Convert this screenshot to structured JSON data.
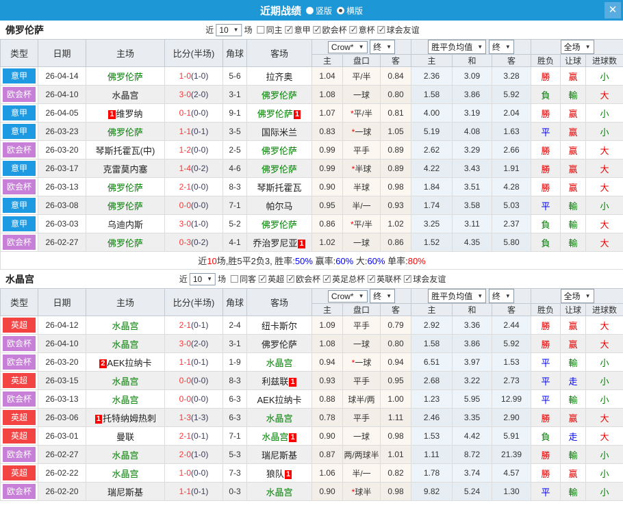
{
  "titlebar": {
    "title": "近期战绩",
    "options": [
      {
        "label": "竖版",
        "checked": false
      },
      {
        "label": "横版",
        "checked": true
      }
    ],
    "close_label": "✕"
  },
  "table_header": {
    "cols": [
      "类型",
      "日期",
      "主场",
      "比分(半场)",
      "角球",
      "客场"
    ],
    "selects": {
      "company": "Crow*",
      "company_term": "终",
      "europe": "胜平负均值",
      "europe_term": "终",
      "scope": "全场"
    },
    "sub": [
      "主",
      "盘口",
      "客",
      "主",
      "和",
      "客",
      "胜负",
      "让球",
      "进球数"
    ]
  },
  "league_colors": {
    "意甲": "#1e9ae2",
    "欧会杯": "#c77fd8",
    "英超": "#f44343"
  },
  "result_colors": {
    "r": "#e60000",
    "g": "#008000",
    "b": "#0000ee"
  },
  "summary_colors": {
    "k": "#333333",
    "r": "#ff0000",
    "b": "#0000ff"
  },
  "sections": [
    {
      "team": "佛罗伦萨",
      "filter": {
        "prefix": "近",
        "count": "10",
        "suffix": "场",
        "same": {
          "label": "同主",
          "checked": false
        },
        "leagues": [
          {
            "label": "意甲",
            "checked": true
          },
          {
            "label": "欧会杯",
            "checked": true
          },
          {
            "label": "意杯",
            "checked": true
          },
          {
            "label": "球会友谊",
            "checked": true
          }
        ]
      },
      "rows": [
        {
          "lg": "意甲",
          "date": "26-04-14",
          "h": "佛罗伦萨",
          "hg": true,
          "hb": "",
          "hbp": "",
          "sc": "1-0",
          "ht": "(1-0)",
          "cn": "5-6",
          "a": "拉齐奥",
          "ag": false,
          "ab": "",
          "abp": "",
          "o1": "1.04",
          "st": false,
          "hc": "平/半",
          "o2": "0.84",
          "e1": "2.36",
          "e2": "3.09",
          "e3": "3.28",
          "r1": "勝",
          "r1c": "r",
          "r2": "赢",
          "r2c": "r",
          "r3": "小",
          "r3c": "g"
        },
        {
          "lg": "欧会杯",
          "date": "26-04-10",
          "h": "水晶宫",
          "hg": false,
          "hb": "",
          "hbp": "",
          "sc": "3-0",
          "ht": "(2-0)",
          "cn": "3-1",
          "a": "佛罗伦萨",
          "ag": true,
          "ab": "",
          "abp": "",
          "o1": "1.08",
          "st": false,
          "hc": "一球",
          "o2": "0.80",
          "e1": "1.58",
          "e2": "3.86",
          "e3": "5.92",
          "r1": "負",
          "r1c": "g",
          "r2": "輸",
          "r2c": "g",
          "r3": "大",
          "r3c": "r"
        },
        {
          "lg": "意甲",
          "date": "26-04-05",
          "h": "维罗纳",
          "hg": false,
          "hb": "1",
          "hbp": "before",
          "sc": "0-1",
          "ht": "(0-0)",
          "cn": "9-1",
          "a": "佛罗伦萨",
          "ag": true,
          "ab": "1",
          "abp": "after",
          "o1": "1.07",
          "st": true,
          "hc": "平/半",
          "o2": "0.81",
          "e1": "4.00",
          "e2": "3.19",
          "e3": "2.04",
          "r1": "勝",
          "r1c": "r",
          "r2": "赢",
          "r2c": "r",
          "r3": "小",
          "r3c": "g"
        },
        {
          "lg": "意甲",
          "date": "26-03-23",
          "h": "佛罗伦萨",
          "hg": true,
          "hb": "",
          "hbp": "",
          "sc": "1-1",
          "ht": "(0-1)",
          "cn": "3-5",
          "a": "国际米兰",
          "ag": false,
          "ab": "",
          "abp": "",
          "o1": "0.83",
          "st": true,
          "hc": "一球",
          "o2": "1.05",
          "e1": "5.19",
          "e2": "4.08",
          "e3": "1.63",
          "r1": "平",
          "r1c": "b",
          "r2": "赢",
          "r2c": "r",
          "r3": "小",
          "r3c": "g"
        },
        {
          "lg": "欧会杯",
          "date": "26-03-20",
          "h": "琴斯托霍瓦(中)",
          "hg": false,
          "hb": "",
          "hbp": "",
          "sc": "1-2",
          "ht": "(0-0)",
          "cn": "2-5",
          "a": "佛罗伦萨",
          "ag": true,
          "ab": "",
          "abp": "",
          "o1": "0.99",
          "st": false,
          "hc": "平手",
          "o2": "0.89",
          "e1": "2.62",
          "e2": "3.29",
          "e3": "2.66",
          "r1": "勝",
          "r1c": "r",
          "r2": "赢",
          "r2c": "r",
          "r3": "大",
          "r3c": "r"
        },
        {
          "lg": "意甲",
          "date": "26-03-17",
          "h": "克雷莫内塞",
          "hg": false,
          "hb": "",
          "hbp": "",
          "sc": "1-4",
          "ht": "(0-2)",
          "cn": "4-6",
          "a": "佛罗伦萨",
          "ag": true,
          "ab": "",
          "abp": "",
          "o1": "0.99",
          "st": true,
          "hc": "半球",
          "o2": "0.89",
          "e1": "4.22",
          "e2": "3.43",
          "e3": "1.91",
          "r1": "勝",
          "r1c": "r",
          "r2": "赢",
          "r2c": "r",
          "r3": "大",
          "r3c": "r"
        },
        {
          "lg": "欧会杯",
          "date": "26-03-13",
          "h": "佛罗伦萨",
          "hg": true,
          "hb": "",
          "hbp": "",
          "sc": "2-1",
          "ht": "(0-0)",
          "cn": "8-3",
          "a": "琴斯托霍瓦",
          "ag": false,
          "ab": "",
          "abp": "",
          "o1": "0.90",
          "st": false,
          "hc": "半球",
          "o2": "0.98",
          "e1": "1.84",
          "e2": "3.51",
          "e3": "4.28",
          "r1": "勝",
          "r1c": "r",
          "r2": "赢",
          "r2c": "r",
          "r3": "大",
          "r3c": "r"
        },
        {
          "lg": "意甲",
          "date": "26-03-08",
          "h": "佛罗伦萨",
          "hg": true,
          "hb": "",
          "hbp": "",
          "sc": "0-0",
          "ht": "(0-0)",
          "cn": "7-1",
          "a": "帕尔马",
          "ag": false,
          "ab": "",
          "abp": "",
          "o1": "0.95",
          "st": false,
          "hc": "半/一",
          "o2": "0.93",
          "e1": "1.74",
          "e2": "3.58",
          "e3": "5.03",
          "r1": "平",
          "r1c": "b",
          "r2": "輸",
          "r2c": "g",
          "r3": "小",
          "r3c": "g"
        },
        {
          "lg": "意甲",
          "date": "26-03-03",
          "h": "乌迪内斯",
          "hg": false,
          "hb": "",
          "hbp": "",
          "sc": "3-0",
          "ht": "(1-0)",
          "cn": "5-2",
          "a": "佛罗伦萨",
          "ag": true,
          "ab": "",
          "abp": "",
          "o1": "0.86",
          "st": true,
          "hc": "平/半",
          "o2": "1.02",
          "e1": "3.25",
          "e2": "3.11",
          "e3": "2.37",
          "r1": "負",
          "r1c": "g",
          "r2": "輸",
          "r2c": "g",
          "r3": "大",
          "r3c": "r"
        },
        {
          "lg": "欧会杯",
          "date": "26-02-27",
          "h": "佛罗伦萨",
          "hg": true,
          "hb": "",
          "hbp": "",
          "sc": "0-3",
          "ht": "(0-2)",
          "cn": "4-1",
          "a": "乔治罗尼亚",
          "ag": false,
          "ab": "1",
          "abp": "after",
          "o1": "1.02",
          "st": false,
          "hc": "一球",
          "o2": "0.86",
          "e1": "1.52",
          "e2": "4.35",
          "e3": "5.80",
          "r1": "負",
          "r1c": "g",
          "r2": "輸",
          "r2c": "g",
          "r3": "大",
          "r3c": "r"
        }
      ],
      "summary": [
        {
          "t": "近",
          "c": "k"
        },
        {
          "t": "10",
          "c": "r"
        },
        {
          "t": "场,胜5平2负3, 胜率:",
          "c": "k"
        },
        {
          "t": "50%",
          "c": "b"
        },
        {
          "t": " 赢率:",
          "c": "k"
        },
        {
          "t": "60%",
          "c": "b"
        },
        {
          "t": " 大:",
          "c": "k"
        },
        {
          "t": "60%",
          "c": "b"
        },
        {
          "t": " 单率:",
          "c": "k"
        },
        {
          "t": "80%",
          "c": "r"
        }
      ]
    },
    {
      "team": "水晶宫",
      "filter": {
        "prefix": "近",
        "count": "10",
        "suffix": "场",
        "same": {
          "label": "同客",
          "checked": false
        },
        "leagues": [
          {
            "label": "英超",
            "checked": true
          },
          {
            "label": "欧会杯",
            "checked": true
          },
          {
            "label": "英足总杯",
            "checked": true
          },
          {
            "label": "英联杯",
            "checked": true
          },
          {
            "label": "球会友谊",
            "checked": true
          }
        ]
      },
      "rows": [
        {
          "lg": "英超",
          "date": "26-04-12",
          "h": "水晶宫",
          "hg": true,
          "hb": "",
          "hbp": "",
          "sc": "2-1",
          "ht": "(0-1)",
          "cn": "2-4",
          "a": "纽卡斯尔",
          "ag": false,
          "ab": "",
          "abp": "",
          "o1": "1.09",
          "st": false,
          "hc": "平手",
          "o2": "0.79",
          "e1": "2.92",
          "e2": "3.36",
          "e3": "2.44",
          "r1": "勝",
          "r1c": "r",
          "r2": "赢",
          "r2c": "r",
          "r3": "大",
          "r3c": "r"
        },
        {
          "lg": "欧会杯",
          "date": "26-04-10",
          "h": "水晶宫",
          "hg": true,
          "hb": "",
          "hbp": "",
          "sc": "3-0",
          "ht": "(2-0)",
          "cn": "3-1",
          "a": "佛罗伦萨",
          "ag": false,
          "ab": "",
          "abp": "",
          "o1": "1.08",
          "st": false,
          "hc": "一球",
          "o2": "0.80",
          "e1": "1.58",
          "e2": "3.86",
          "e3": "5.92",
          "r1": "勝",
          "r1c": "r",
          "r2": "赢",
          "r2c": "r",
          "r3": "大",
          "r3c": "r"
        },
        {
          "lg": "欧会杯",
          "date": "26-03-20",
          "h": "AEK拉纳卡",
          "hg": false,
          "hb": "2",
          "hbp": "before",
          "sc": "1-1",
          "ht": "(0-1)",
          "cn": "1-9",
          "a": "水晶宫",
          "ag": true,
          "ab": "",
          "abp": "",
          "o1": "0.94",
          "st": true,
          "hc": "一球",
          "o2": "0.94",
          "e1": "6.51",
          "e2": "3.97",
          "e3": "1.53",
          "r1": "平",
          "r1c": "b",
          "r2": "輸",
          "r2c": "g",
          "r3": "小",
          "r3c": "g"
        },
        {
          "lg": "英超",
          "date": "26-03-15",
          "h": "水晶宫",
          "hg": true,
          "hb": "",
          "hbp": "",
          "sc": "0-0",
          "ht": "(0-0)",
          "cn": "8-3",
          "a": "利兹联",
          "ag": false,
          "ab": "1",
          "abp": "after",
          "o1": "0.93",
          "st": false,
          "hc": "平手",
          "o2": "0.95",
          "e1": "2.68",
          "e2": "3.22",
          "e3": "2.73",
          "r1": "平",
          "r1c": "b",
          "r2": "走",
          "r2c": "b",
          "r3": "小",
          "r3c": "g"
        },
        {
          "lg": "欧会杯",
          "date": "26-03-13",
          "h": "水晶宫",
          "hg": true,
          "hb": "",
          "hbp": "",
          "sc": "0-0",
          "ht": "(0-0)",
          "cn": "6-3",
          "a": "AEK拉纳卡",
          "ag": false,
          "ab": "",
          "abp": "",
          "o1": "0.88",
          "st": false,
          "hc": "球半/两",
          "o2": "1.00",
          "e1": "1.23",
          "e2": "5.95",
          "e3": "12.99",
          "r1": "平",
          "r1c": "b",
          "r2": "輸",
          "r2c": "g",
          "r3": "小",
          "r3c": "g"
        },
        {
          "lg": "英超",
          "date": "26-03-06",
          "h": "托特纳姆热刺",
          "hg": false,
          "hb": "1",
          "hbp": "before",
          "sc": "1-3",
          "ht": "(1-3)",
          "cn": "6-3",
          "a": "水晶宫",
          "ag": true,
          "ab": "",
          "abp": "",
          "o1": "0.78",
          "st": false,
          "hc": "平手",
          "o2": "1.11",
          "e1": "2.46",
          "e2": "3.35",
          "e3": "2.90",
          "r1": "勝",
          "r1c": "r",
          "r2": "赢",
          "r2c": "r",
          "r3": "大",
          "r3c": "r"
        },
        {
          "lg": "英超",
          "date": "26-03-01",
          "h": "曼联",
          "hg": false,
          "hb": "",
          "hbp": "",
          "sc": "2-1",
          "ht": "(0-1)",
          "cn": "7-1",
          "a": "水晶宫",
          "ag": true,
          "ab": "1",
          "abp": "after",
          "o1": "0.90",
          "st": false,
          "hc": "一球",
          "o2": "0.98",
          "e1": "1.53",
          "e2": "4.42",
          "e3": "5.91",
          "r1": "負",
          "r1c": "g",
          "r2": "走",
          "r2c": "b",
          "r3": "大",
          "r3c": "r"
        },
        {
          "lg": "欧会杯",
          "date": "26-02-27",
          "h": "水晶宫",
          "hg": true,
          "hb": "",
          "hbp": "",
          "sc": "2-0",
          "ht": "(1-0)",
          "cn": "5-3",
          "a": "瑞尼斯基",
          "ag": false,
          "ab": "",
          "abp": "",
          "o1": "0.87",
          "st": false,
          "hc": "两/两球半",
          "o2": "1.01",
          "e1": "1.11",
          "e2": "8.72",
          "e3": "21.39",
          "r1": "勝",
          "r1c": "r",
          "r2": "輸",
          "r2c": "g",
          "r3": "小",
          "r3c": "g"
        },
        {
          "lg": "英超",
          "date": "26-02-22",
          "h": "水晶宫",
          "hg": true,
          "hb": "",
          "hbp": "",
          "sc": "1-0",
          "ht": "(0-0)",
          "cn": "7-3",
          "a": "狼队",
          "ag": false,
          "ab": "1",
          "abp": "after",
          "o1": "1.06",
          "st": false,
          "hc": "半/一",
          "o2": "0.82",
          "e1": "1.78",
          "e2": "3.74",
          "e3": "4.57",
          "r1": "勝",
          "r1c": "r",
          "r2": "赢",
          "r2c": "r",
          "r3": "小",
          "r3c": "g"
        },
        {
          "lg": "欧会杯",
          "date": "26-02-20",
          "h": "瑞尼斯基",
          "hg": false,
          "hb": "",
          "hbp": "",
          "sc": "1-1",
          "ht": "(0-1)",
          "cn": "0-3",
          "a": "水晶宫",
          "ag": true,
          "ab": "",
          "abp": "",
          "o1": "0.90",
          "st": true,
          "hc": "球半",
          "o2": "0.98",
          "e1": "9.82",
          "e2": "5.24",
          "e3": "1.30",
          "r1": "平",
          "r1c": "b",
          "r2": "輸",
          "r2c": "g",
          "r3": "小",
          "r3c": "g"
        }
      ]
    }
  ]
}
